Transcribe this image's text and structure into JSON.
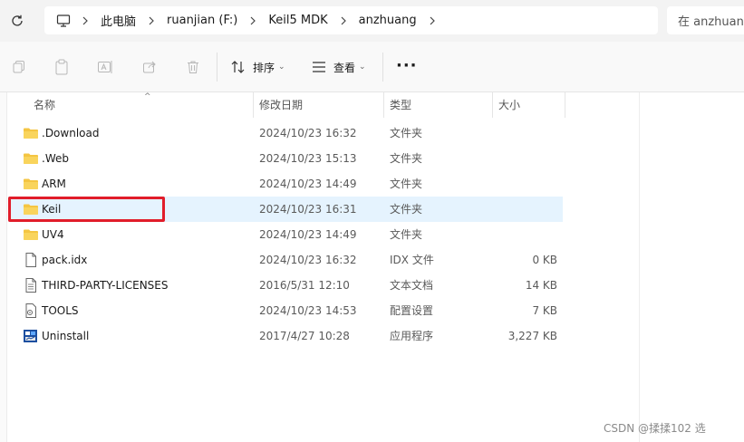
{
  "address": {
    "crumbs": [
      "此电脑",
      "ruanjian (F:)",
      "Keil5 MDK",
      "anzhuang"
    ],
    "search_placeholder": "在 anzhuang"
  },
  "toolbar": {
    "sort_label": "排序",
    "view_label": "查看",
    "more_label": "···"
  },
  "columns": {
    "name": "名称",
    "date": "修改日期",
    "type": "类型",
    "size": "大小"
  },
  "files": [
    {
      "name": ".Download",
      "date": "2024/10/23 16:32",
      "type": "文件夹",
      "size": "",
      "icon": "folder-icon"
    },
    {
      "name": ".Web",
      "date": "2024/10/23 15:13",
      "type": "文件夹",
      "size": "",
      "icon": "folder-icon"
    },
    {
      "name": "ARM",
      "date": "2024/10/23 14:49",
      "type": "文件夹",
      "size": "",
      "icon": "folder-icon"
    },
    {
      "name": "Keil",
      "date": "2024/10/23 16:31",
      "type": "文件夹",
      "size": "",
      "icon": "folder-icon"
    },
    {
      "name": "UV4",
      "date": "2024/10/23 14:49",
      "type": "文件夹",
      "size": "",
      "icon": "folder-icon"
    },
    {
      "name": "pack.idx",
      "date": "2024/10/23 16:32",
      "type": "IDX 文件",
      "size": "0 KB",
      "icon": "file-icon"
    },
    {
      "name": "THIRD-PARTY-LICENSES",
      "date": "2016/5/31 12:10",
      "type": "文本文档",
      "size": "14 KB",
      "icon": "text-file-icon"
    },
    {
      "name": "TOOLS",
      "date": "2024/10/23 14:53",
      "type": "配置设置",
      "size": "7 KB",
      "icon": "settings-file-icon"
    },
    {
      "name": "Uninstall",
      "date": "2017/4/27 10:28",
      "type": "应用程序",
      "size": "3,227 KB",
      "icon": "app-icon"
    }
  ],
  "selected_row": "Keil",
  "colors": {
    "folder": "#f4c542",
    "selected_bg": "#e5f3fe",
    "highlight": "#e11d2a"
  },
  "watermark": "CSDN @揉揉102 选"
}
